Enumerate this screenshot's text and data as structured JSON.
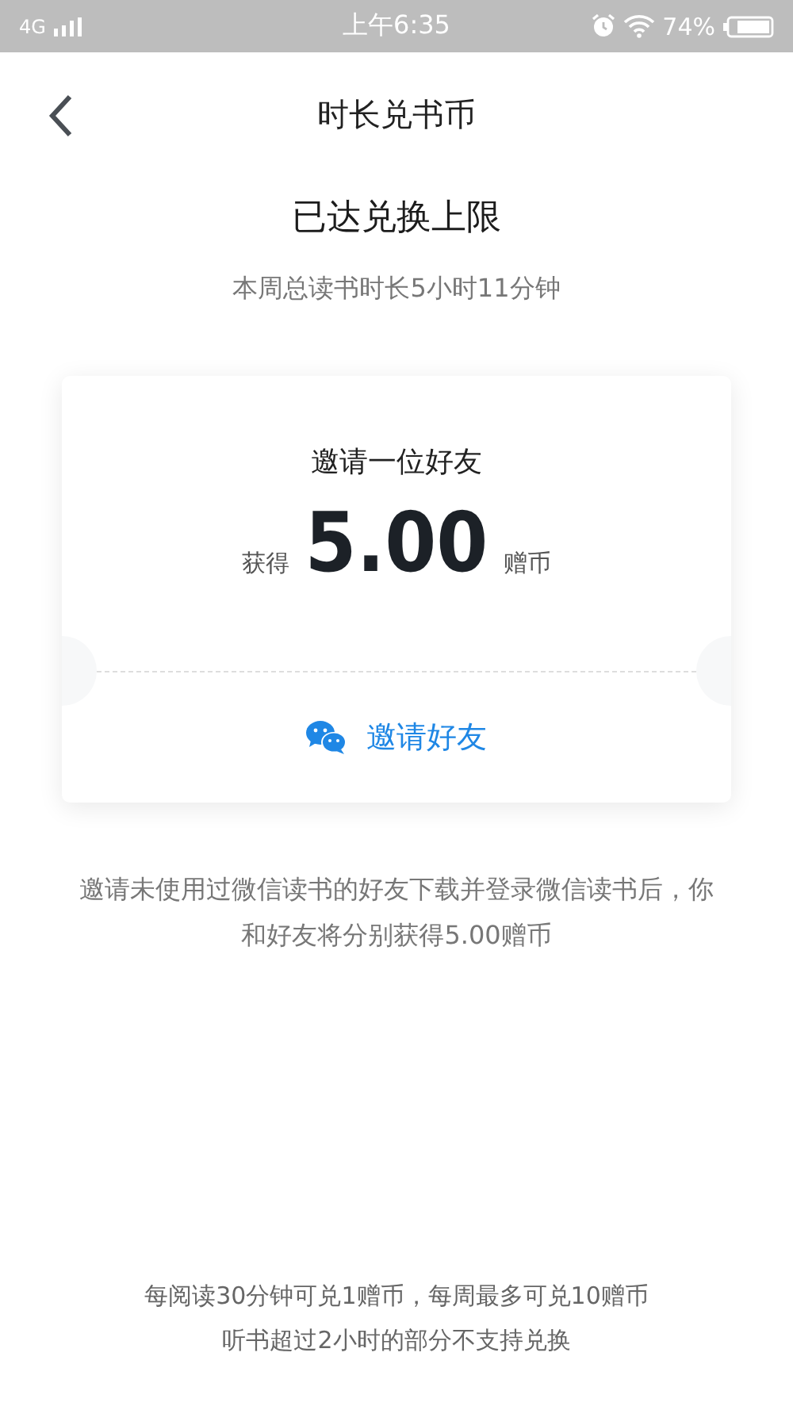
{
  "status_bar": {
    "network": "4G",
    "time": "上午6:35",
    "battery": "74%"
  },
  "header": {
    "title": "时长兑书币"
  },
  "status": {
    "title": "已达兑换上限",
    "subtitle": "本周总读书时长5小时11分钟"
  },
  "card": {
    "title": "邀请一位好友",
    "prefix": "获得",
    "amount": "5.00",
    "unit": "赠币",
    "button": "邀请好友"
  },
  "description": "邀请未使用过微信读书的好友下载并登录微信读书后，你和好友将分别获得5.00赠币",
  "footer": [
    "每阅读30分钟可兑1赠币，每周最多可兑10赠币",
    "听书超过2小时的部分不支持兑换"
  ]
}
